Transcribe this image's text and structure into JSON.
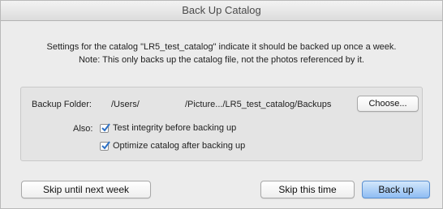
{
  "dialog": {
    "title": "Back Up Catalog",
    "message_line1": "Settings for the catalog \"LR5_test_catalog\" indicate it should be backed up once a week.",
    "message_line2": "Note: This only backs up the catalog file, not the photos referenced by it."
  },
  "backup": {
    "folder_label": "Backup Folder:",
    "path_start": "/Users/",
    "path_end": "/Picture.../LR5_test_catalog/Backups",
    "choose_label": "Choose..."
  },
  "also": {
    "label": "Also:",
    "options": [
      {
        "label": "Test integrity before backing up",
        "checked": true
      },
      {
        "label": "Optimize catalog after backing up",
        "checked": true
      }
    ]
  },
  "buttons": {
    "skip_week": "Skip until next week",
    "skip_time": "Skip this time",
    "back_up": "Back up"
  },
  "colors": {
    "accent": "#8fbdf3",
    "check": "#2b6fc4"
  }
}
